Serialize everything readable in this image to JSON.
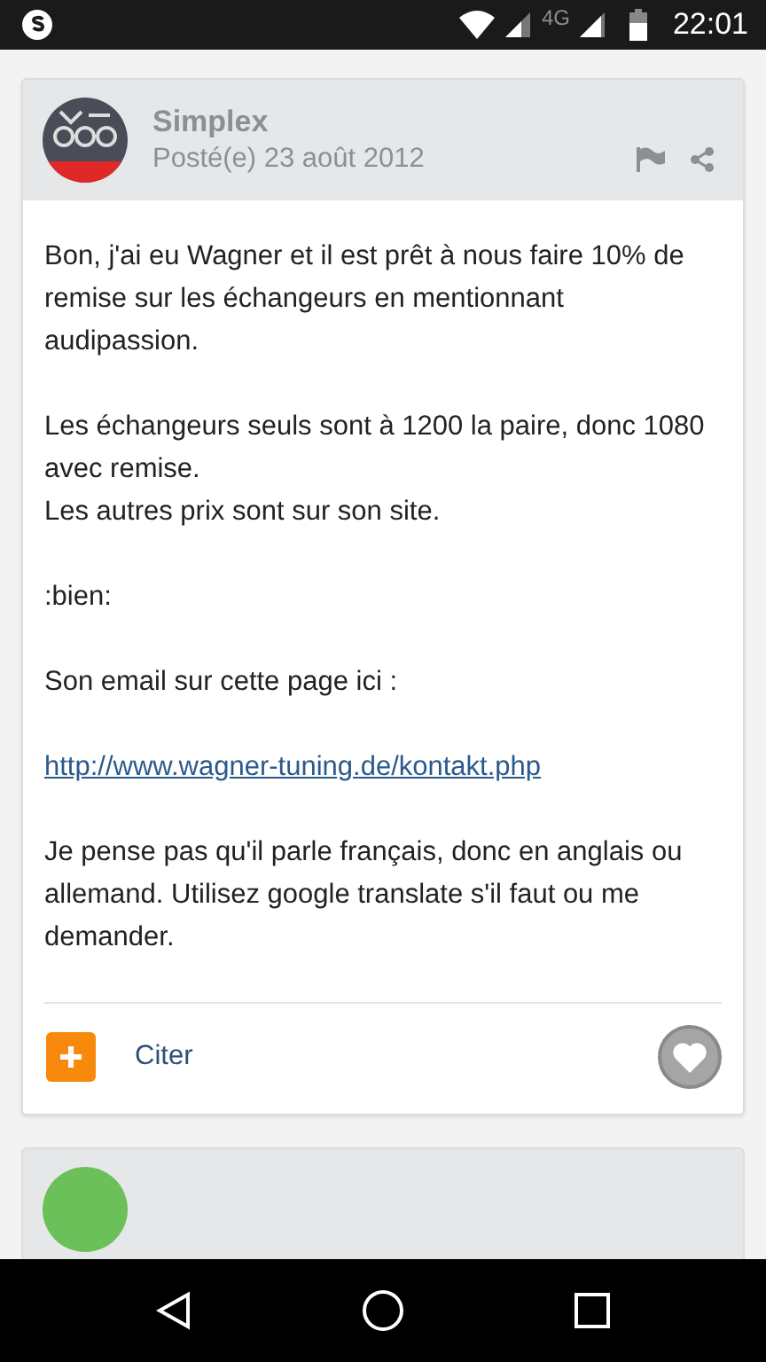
{
  "status_bar": {
    "network": "4G",
    "time": "22:01"
  },
  "post": {
    "author": "Simplex",
    "date": "Posté(e) 23 août 2012",
    "paragraphs": [
      {
        "kind": "text",
        "lines": [
          "Bon, j'ai eu Wagner et il est prêt à nous faire 10% de remise sur les échangeurs en mentionnant audipassion."
        ]
      },
      {
        "kind": "text",
        "lines": [
          "Les échangeurs seuls sont à 1200 la paire, donc 1080 avec remise.",
          "Les autres prix sont sur son site."
        ]
      },
      {
        "kind": "text",
        "lines": [
          ":bien:"
        ]
      },
      {
        "kind": "text",
        "lines": [
          "Son email sur cette page ici :"
        ]
      },
      {
        "kind": "link",
        "lines": [
          "http://www.wagner-tuning.de/kontakt.php"
        ]
      },
      {
        "kind": "text",
        "lines": [
          "Je pense pas qu'il parle français, donc en anglais ou allemand. Utilisez google translate s'il faut ou me demander."
        ]
      }
    ],
    "quote_label": "Citer"
  }
}
